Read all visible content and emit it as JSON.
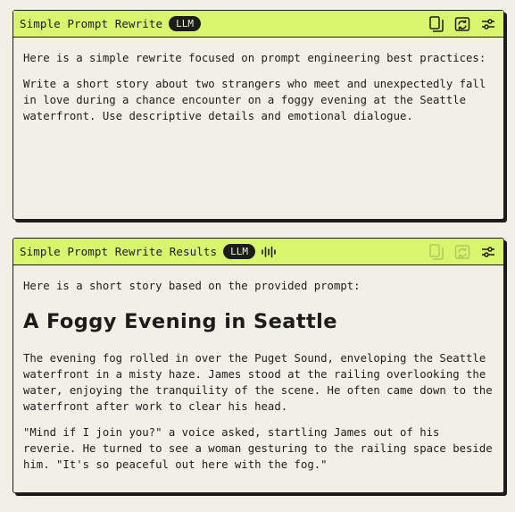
{
  "panel1": {
    "title": "Simple Prompt Rewrite",
    "badge": "LLM",
    "icons": [
      "copy-icon",
      "refresh-icon",
      "settings-sliders-icon"
    ],
    "intro": "Here is a simple rewrite focused on prompt engineering best practices:",
    "body": "Write a short story about two strangers who meet and unexpectedly fall in love during a chance encounter on a foggy evening at the Seattle waterfront. Use descriptive details and emotional dialogue."
  },
  "panel2": {
    "title": "Simple Prompt Rewrite Results",
    "badge": "LLM",
    "icons": [
      "audio-wave-icon",
      "copy-icon",
      "refresh-icon",
      "settings-sliders-icon"
    ],
    "intro": "Here is a short story based on the provided prompt:",
    "story_title": "A Foggy Evening in Seattle",
    "paragraph1": "The evening fog rolled in over the Puget Sound, enveloping the Seattle waterfront in a misty haze. James stood at the railing overlooking the water, enjoying the tranquility of the scene. He often came down to the waterfront after work to clear his head.",
    "paragraph2": "\"Mind if I join you?\" a voice asked, startling James out of his reverie. He turned to see a woman gesturing to the railing space beside him. \"It's so peaceful out here with the fog.\""
  },
  "colors": {
    "header_bg": "#d9f56e",
    "page_bg": "#f2f0e6",
    "ink": "#1c1c1c"
  }
}
